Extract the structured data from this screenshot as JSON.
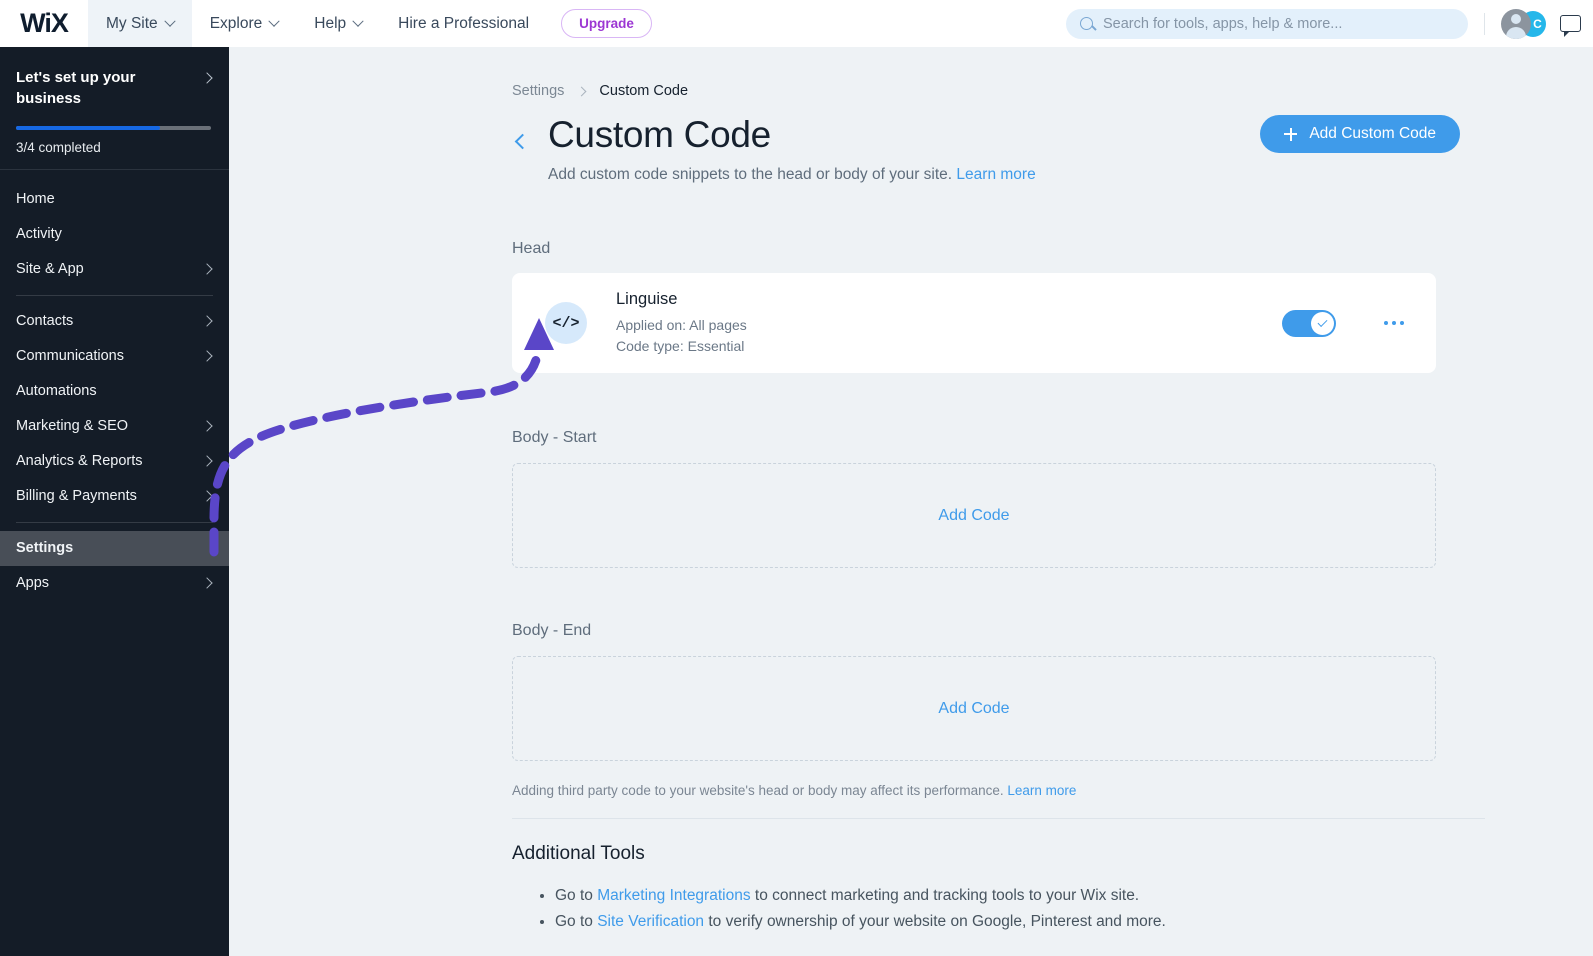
{
  "topbar": {
    "logo": "WiX",
    "logo_icon": "wix-logo-icon",
    "tabs": [
      {
        "label": "My Site",
        "has_caret": true,
        "active": true
      },
      {
        "label": "Explore",
        "has_caret": true,
        "active": false
      },
      {
        "label": "Help",
        "has_caret": true,
        "active": false
      },
      {
        "label": "Hire a Professional",
        "has_caret": false,
        "active": false
      }
    ],
    "upgrade_label": "Upgrade",
    "search": {
      "placeholder": "Search for tools, apps, help & more...",
      "value": "",
      "icon": "search-icon"
    },
    "avatar_badge": "C",
    "chat_icon": "chat-bubble-icon"
  },
  "sidebar": {
    "setup": {
      "title": "Let's set up your business",
      "progress_text": "3/4 completed",
      "progress_percent": 74
    },
    "items": [
      {
        "label": "Home",
        "chevron": false,
        "selected": false,
        "divider_after": false
      },
      {
        "label": "Activity",
        "chevron": false,
        "selected": false,
        "divider_after": false
      },
      {
        "label": "Site & App",
        "chevron": true,
        "selected": false,
        "divider_after": true
      },
      {
        "label": "Contacts",
        "chevron": true,
        "selected": false,
        "divider_after": false
      },
      {
        "label": "Communications",
        "chevron": true,
        "selected": false,
        "divider_after": false
      },
      {
        "label": "Automations",
        "chevron": false,
        "selected": false,
        "divider_after": false
      },
      {
        "label": "Marketing & SEO",
        "chevron": true,
        "selected": false,
        "divider_after": false
      },
      {
        "label": "Analytics & Reports",
        "chevron": true,
        "selected": false,
        "divider_after": false
      },
      {
        "label": "Billing & Payments",
        "chevron": true,
        "selected": false,
        "divider_after": true
      },
      {
        "label": "Settings",
        "chevron": false,
        "selected": true,
        "divider_after": false
      },
      {
        "label": "Apps",
        "chevron": true,
        "selected": false,
        "divider_after": false
      }
    ]
  },
  "main": {
    "breadcrumb": {
      "parent": "Settings",
      "current": "Custom Code"
    },
    "title": "Custom Code",
    "subtitle": "Add custom code snippets to the head or body of your site.",
    "subtitle_link": "Learn more",
    "cta_label": "Add Custom Code",
    "sections": {
      "head_label": "Head",
      "body_start_label": "Body - Start",
      "body_end_label": "Body - End"
    },
    "snippet": {
      "icon_glyph": "</>",
      "name": "Linguise",
      "applied_on": "Applied on: All pages",
      "code_type": "Code type: Essential",
      "toggle_on": true,
      "menu_icon": "more-options-icon"
    },
    "add_code_label": "Add Code",
    "disclaimer": "Adding third party code to your website's head or body may affect its performance.",
    "disclaimer_link": "Learn more",
    "additional_tools": {
      "title": "Additional Tools",
      "items": [
        {
          "prefix": "Go to ",
          "link": "Marketing Integrations",
          "suffix": " to connect marketing and tracking tools to your Wix site."
        },
        {
          "prefix": "Go to ",
          "link": "Site Verification",
          "suffix": " to verify ownership of your website on Google, Pinterest and more."
        }
      ]
    }
  },
  "annotation": {
    "type": "dashed-arrow",
    "color": "#5a46c8",
    "points_to": "custom-code-snippet-icon"
  }
}
